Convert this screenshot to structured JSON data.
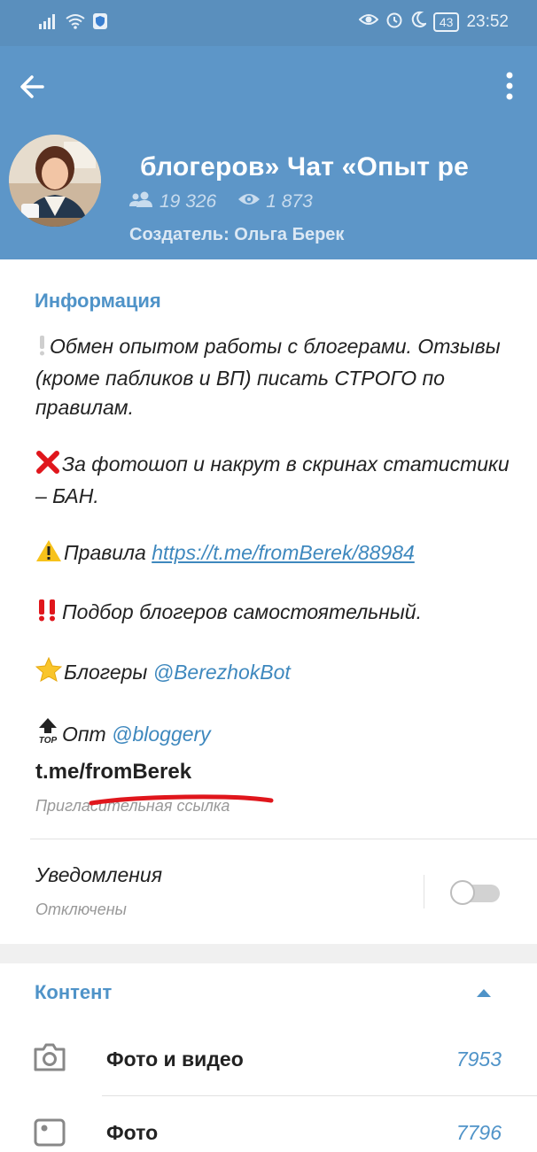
{
  "status_bar": {
    "time": "23:52",
    "battery": "43"
  },
  "header": {
    "title": "блогеров»   Чат «Опыт ре",
    "members": "19 326",
    "online": "1 873",
    "creator": "Создатель: Ольга Берек"
  },
  "info": {
    "section_title": "Информация",
    "p1": "Обмен опытом работы с блогерами. Отзывы (кроме пабликов и ВП) писать СТРОГО по правилам.",
    "p2": "За фотошоп и накрут в скринах статистики – БАН.",
    "p3_text": "Правила ",
    "p3_link": "https://t.me/fromBerek/88984",
    "p4": "Подбор блогеров самостоятельный.",
    "p5_text": "Блогеры ",
    "p5_mention": "@BerezhokBot",
    "p6_text": "Опт ",
    "p6_mention": "@bloggery",
    "invite_link": "t.me/fromBerek",
    "invite_label": "Пригласительная ссылка"
  },
  "notifications": {
    "label": "Уведомления",
    "status": "Отключены",
    "enabled": false
  },
  "content": {
    "section_title": "Контент",
    "items": [
      {
        "label": "Фото и видео",
        "count": "7953",
        "icon": "camera-icon"
      },
      {
        "label": "Фото",
        "count": "7796",
        "icon": "photo-icon"
      }
    ]
  },
  "colors": {
    "header": "#5d96c8",
    "accent": "#4f93c8",
    "annotation": "#e0161c"
  }
}
